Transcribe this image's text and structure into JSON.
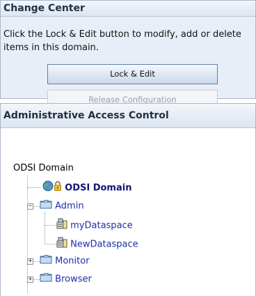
{
  "change_center": {
    "title": "Change Center",
    "message": "Click the Lock & Edit button to modify, add or delete items in this domain.",
    "lock_edit_label": "Lock & Edit",
    "release_label": "Release Configuration"
  },
  "access_control": {
    "title": "Administrative Access Control",
    "root_label": "ODSI Domain",
    "domain_node": "ODSI Domain",
    "admin": "Admin",
    "dataspaces": [
      "myDataspace",
      "NewDataspace"
    ],
    "monitor": "Monitor",
    "browser": "Browser"
  },
  "colors": {
    "link": "#1a2fa3",
    "panel_bg": "#e8eef7",
    "border": "#a9b6c8"
  }
}
